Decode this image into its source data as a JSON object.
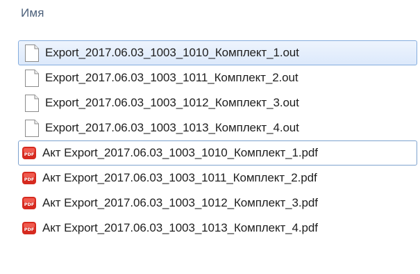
{
  "header": {
    "name_column": "Имя"
  },
  "files": [
    {
      "name": "Export_2017.06.03_1003_1010_Комплект_1.out",
      "type": "out",
      "icon": "blank-document-icon",
      "selected": true
    },
    {
      "name": "Export_2017.06.03_1003_1011_Комплект_2.out",
      "type": "out",
      "icon": "blank-document-icon",
      "selected": false
    },
    {
      "name": "Export_2017.06.03_1003_1012_Комплект_3.out",
      "type": "out",
      "icon": "blank-document-icon",
      "selected": false
    },
    {
      "name": "Export_2017.06.03_1003_1013_Комплект_4.out",
      "type": "out",
      "icon": "blank-document-icon",
      "selected": false
    },
    {
      "name": "Акт Export_2017.06.03_1003_1010_Комплект_1.pdf",
      "type": "pdf",
      "icon": "pdf-document-icon",
      "focused": true
    },
    {
      "name": "Акт Export_2017.06.03_1003_1011_Комплект_2.pdf",
      "type": "pdf",
      "icon": "pdf-document-icon"
    },
    {
      "name": "Акт Export_2017.06.03_1003_1012_Комплект_3.pdf",
      "type": "pdf",
      "icon": "pdf-document-icon"
    },
    {
      "name": "Акт Export_2017.06.03_1003_1013_Комплект_4.pdf",
      "type": "pdf",
      "icon": "pdf-document-icon"
    }
  ],
  "colors": {
    "header_text": "#4c607a",
    "selection_border": "#84acdd",
    "selection_fill": "#dce9fb",
    "pdf_red": "#d62a1f"
  }
}
